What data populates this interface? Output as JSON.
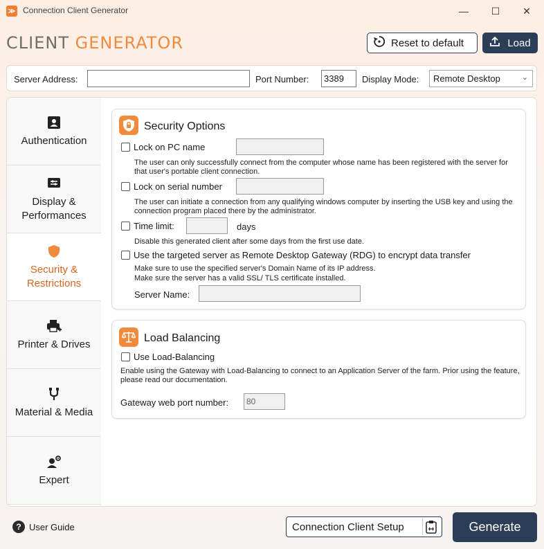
{
  "window": {
    "title": "Connection Client Generator",
    "minimize": "—",
    "maximize": "☐",
    "close": "✕"
  },
  "brand": {
    "part1": "CLIENT ",
    "part2": "GENERATOR"
  },
  "header": {
    "reset_label": "Reset to default",
    "load_label": "Load"
  },
  "topbar": {
    "server_address_label": "Server Address:",
    "server_address_value": "",
    "port_label": "Port Number:",
    "port_value": "3389",
    "display_mode_label": "Display Mode:",
    "display_mode_value": "Remote Desktop"
  },
  "sidebar": {
    "items": [
      {
        "label": "Authentication",
        "icon": "user-card-icon"
      },
      {
        "label": "Display & Performances",
        "icon": "display-icon"
      },
      {
        "label": "Security & Restrictions",
        "icon": "shield-icon",
        "active": true
      },
      {
        "label": "Printer & Drives",
        "icon": "printer-icon"
      },
      {
        "label": "Material & Media",
        "icon": "usb-icon"
      },
      {
        "label": "Expert",
        "icon": "expert-icon"
      }
    ]
  },
  "security": {
    "title": "Security Options",
    "lock_pc_label": "Lock on PC name",
    "lock_pc_desc": "The user can only successfully connect from the computer whose name has been registered with the server for that user's portable client connection.",
    "lock_serial_label": "Lock on serial number",
    "lock_serial_desc": "The user can initiate a connection from any qualifying windows computer by inserting the USB key and using the connection program placed there by the administrator.",
    "time_limit_label": "Time limit:",
    "days_label": "days",
    "time_limit_desc": "Disable this generated client after some days from the first use date.",
    "rdg_label": "Use the targeted server as Remote Desktop Gateway (RDG) to encrypt data transfer",
    "rdg_desc_1": "Make sure to use the specified server's Domain Name of its IP address.",
    "rdg_desc_2": "Make sure the server has a valid SSL/ TLS certificate installed.",
    "server_name_label": "Server Name:"
  },
  "load_balancing": {
    "title": "Load Balancing",
    "use_label": "Use Load-Balancing",
    "desc": "Enable using the Gateway with Load-Balancing to connect to an Application Server of the farm. Prior using the feature, please read our documentation.",
    "port_label": "Gateway web port number:",
    "port_value": "80"
  },
  "footer": {
    "user_guide": "User Guide",
    "setup_label": "Connection Client Setup",
    "generate_label": "Generate"
  },
  "colors": {
    "accent": "#ef8b3f",
    "navy": "#2c3d57",
    "active_text": "#d8651f"
  }
}
